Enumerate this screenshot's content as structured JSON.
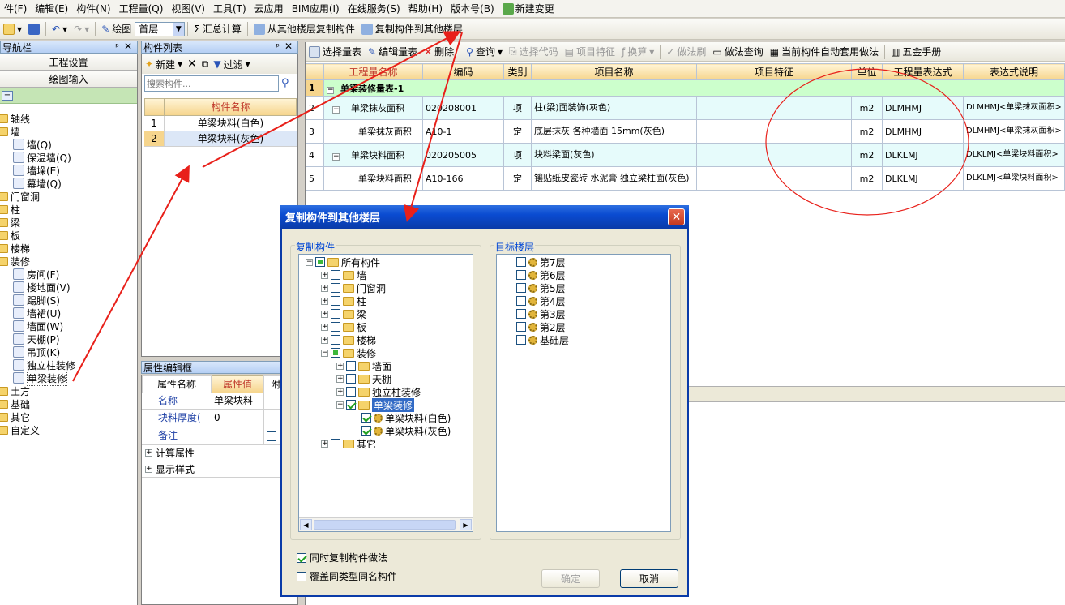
{
  "menu": [
    "件(F)",
    "编辑(E)",
    "构件(N)",
    "工程量(Q)",
    "视图(V)",
    "工具(T)",
    "云应用",
    "BIM应用(I)",
    "在线服务(S)",
    "帮助(H)",
    "版本号(B)",
    "新建变更"
  ],
  "toolbar": {
    "draw_label": "绘图",
    "floor_select": "首层",
    "sum_label": "汇总计算",
    "copy_from_label": "从其他楼层复制构件",
    "copy_to_label": "复制构件到其他楼层"
  },
  "nav": {
    "title": "导航栏",
    "btn_project": "工程设置",
    "btn_draw": "绘图输入",
    "tree": [
      {
        "label": "轴线",
        "level": 0,
        "kind": "folder"
      },
      {
        "label": "墙",
        "level": 0,
        "kind": "folder"
      },
      {
        "label": "墙(Q)",
        "level": 1,
        "kind": "icon"
      },
      {
        "label": "保温墙(Q)",
        "level": 1,
        "kind": "icon"
      },
      {
        "label": "墙垛(E)",
        "level": 1,
        "kind": "icon"
      },
      {
        "label": "幕墙(Q)",
        "level": 1,
        "kind": "icon"
      },
      {
        "label": "门窗洞",
        "level": 0,
        "kind": "folder"
      },
      {
        "label": "柱",
        "level": 0,
        "kind": "folder"
      },
      {
        "label": "梁",
        "level": 0,
        "kind": "folder"
      },
      {
        "label": "板",
        "level": 0,
        "kind": "folder"
      },
      {
        "label": "楼梯",
        "level": 0,
        "kind": "folder"
      },
      {
        "label": "装修",
        "level": 0,
        "kind": "folder"
      },
      {
        "label": "房间(F)",
        "level": 1,
        "kind": "icon"
      },
      {
        "label": "楼地面(V)",
        "level": 1,
        "kind": "icon"
      },
      {
        "label": "踢脚(S)",
        "level": 1,
        "kind": "icon"
      },
      {
        "label": "墙裙(U)",
        "level": 1,
        "kind": "icon"
      },
      {
        "label": "墙面(W)",
        "level": 1,
        "kind": "icon"
      },
      {
        "label": "天棚(P)",
        "level": 1,
        "kind": "icon"
      },
      {
        "label": "吊顶(K)",
        "level": 1,
        "kind": "icon"
      },
      {
        "label": "独立柱装修",
        "level": 1,
        "kind": "icon"
      },
      {
        "label": "单梁装修",
        "level": 1,
        "kind": "icon"
      },
      {
        "label": "土方",
        "level": 0,
        "kind": "folder"
      },
      {
        "label": "基础",
        "level": 0,
        "kind": "folder"
      },
      {
        "label": "其它",
        "level": 0,
        "kind": "folder"
      },
      {
        "label": "自定义",
        "level": 0,
        "kind": "folder"
      }
    ]
  },
  "complist": {
    "title": "构件列表",
    "new_label": "新建",
    "filter_label": "过滤",
    "search_placeholder": "搜索构件...",
    "col_name": "构件名称",
    "rows": [
      {
        "num": "1",
        "name": "单梁块料(白色)"
      },
      {
        "num": "2",
        "name": "单梁块料(灰色)"
      }
    ]
  },
  "props": {
    "title": "属性编辑框",
    "col_name": "属性名称",
    "col_value": "属性值",
    "col_extra": "附加",
    "rows": [
      {
        "name": "名称",
        "value": "单梁块料"
      },
      {
        "name": "块料厚度(",
        "value": "0"
      },
      {
        "name": "备注",
        "value": ""
      }
    ],
    "groups": [
      "计算属性",
      "显示样式"
    ]
  },
  "qty_toolbar": [
    "选择量表",
    "编辑量表",
    "删除",
    "查询",
    "选择代码",
    "项目特征",
    "换算",
    "做法刷",
    "做法查询",
    "当前构件自动套用做法",
    "五金手册"
  ],
  "qty_table": {
    "headers": [
      "工程量名称",
      "编码",
      "类别",
      "项目名称",
      "项目特征",
      "单位",
      "工程量表达式",
      "表达式说明"
    ],
    "group_row": {
      "num": "1",
      "name": "单梁装修量表-1"
    },
    "rows": [
      {
        "num": "2",
        "name": "单梁抹灰面积",
        "code": "020208001",
        "type": "项",
        "item": "柱(梁)面装饰(灰色)",
        "feature": "",
        "unit": "m2",
        "expr": "DLMHMJ",
        "desc": "DLMHMJ<单梁抹灰面积>"
      },
      {
        "num": "3",
        "name": "单梁抹灰面积",
        "code": "A10-1",
        "type": "定",
        "item": "底层抹灰 各种墙面 15mm(灰色)",
        "feature": "",
        "unit": "m2",
        "expr": "DLMHMJ",
        "desc": "DLMHMJ<单梁抹灰面积>"
      },
      {
        "num": "4",
        "name": "单梁块料面积",
        "code": "020205005",
        "type": "项",
        "item": "块料梁面(灰色)",
        "feature": "",
        "unit": "m2",
        "expr": "DLKLMJ",
        "desc": "DLKLMJ<单梁块料面积>"
      },
      {
        "num": "5",
        "name": "单梁块料面积",
        "code": "A10-166",
        "type": "定",
        "item": "镶贴纸皮瓷砖 水泥膏 独立梁柱面(灰色)",
        "feature": "",
        "unit": "m2",
        "expr": "DLKLMJ",
        "desc": "DLKLMJ<单梁块料面积>"
      }
    ]
  },
  "dialog": {
    "title": "复制构件到其他楼层",
    "copy_group_label": "复制构件",
    "target_group_label": "目标楼层",
    "tree": [
      {
        "label": "所有构件",
        "level": 0,
        "state": "part",
        "expander": "-"
      },
      {
        "label": "墙",
        "level": 1,
        "state": "off",
        "expander": "+"
      },
      {
        "label": "门窗洞",
        "level": 1,
        "state": "off",
        "expander": "+"
      },
      {
        "label": "柱",
        "level": 1,
        "state": "off",
        "expander": "+"
      },
      {
        "label": "梁",
        "level": 1,
        "state": "off",
        "expander": "+"
      },
      {
        "label": "板",
        "level": 1,
        "state": "off",
        "expander": "+"
      },
      {
        "label": "楼梯",
        "level": 1,
        "state": "off",
        "expander": "+"
      },
      {
        "label": "装修",
        "level": 1,
        "state": "part",
        "expander": "-"
      },
      {
        "label": "墙面",
        "level": 2,
        "state": "off",
        "expander": "+"
      },
      {
        "label": "天棚",
        "level": 2,
        "state": "off",
        "expander": "+"
      },
      {
        "label": "独立柱装修",
        "level": 2,
        "state": "off",
        "expander": "+"
      },
      {
        "label": "单梁装修",
        "level": 2,
        "state": "on",
        "expander": "-",
        "selected": true
      },
      {
        "label": "单梁块料(白色)",
        "level": 3,
        "state": "on",
        "expander": ""
      },
      {
        "label": "单梁块料(灰色)",
        "level": 3,
        "state": "on",
        "expander": ""
      },
      {
        "label": "其它",
        "level": 1,
        "state": "off",
        "expander": "+"
      }
    ],
    "floors": [
      "第7层",
      "第6层",
      "第5层",
      "第4层",
      "第3层",
      "第2层",
      "基础层"
    ],
    "opt_copy_method": "同时复制构件做法",
    "opt_copy_method_checked": true,
    "opt_overwrite": "覆盖同类型同名构件",
    "opt_overwrite_checked": false,
    "ok_label": "确定",
    "cancel_label": "取消"
  },
  "colors": {
    "selected_row": "#dce7f7",
    "group_row": "#ccffcc",
    "accent": "#0a3ba8",
    "annotation": "#e8201a"
  }
}
